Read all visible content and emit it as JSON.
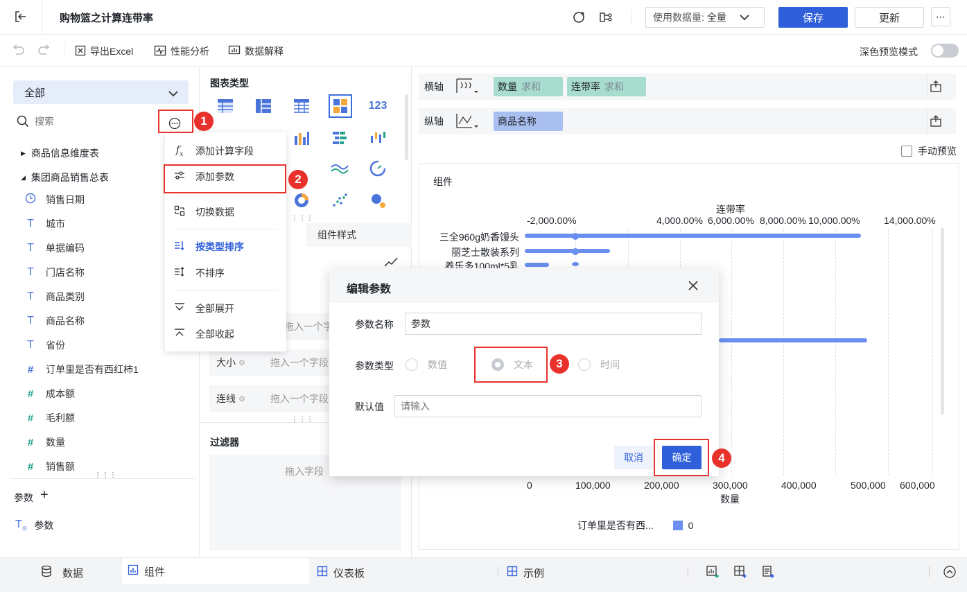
{
  "header": {
    "title": "购物篮之计算连带率",
    "data_volume_label": "使用数据量:",
    "data_volume_value": "全量",
    "save": "保存",
    "update": "更新"
  },
  "toolbar": {
    "export_excel": "导出Excel",
    "perf_analysis": "性能分析",
    "data_explain": "数据解释",
    "dark_preview": "深色预览模式"
  },
  "left": {
    "dataset_select": "全部",
    "search_placeholder": "搜索",
    "tables": [
      {
        "name": "商品信息维度表",
        "expanded": false
      },
      {
        "name": "集团商品销售总表",
        "expanded": true
      }
    ],
    "fields": [
      {
        "name": "销售日期",
        "type": "date"
      },
      {
        "name": "城市",
        "type": "text"
      },
      {
        "name": "单据编码",
        "type": "text"
      },
      {
        "name": "门店名称",
        "type": "text"
      },
      {
        "name": "商品类别",
        "type": "text"
      },
      {
        "name": "商品名称",
        "type": "text"
      },
      {
        "name": "省份",
        "type": "text"
      },
      {
        "name": "订单里是否有西红柿1",
        "type": "calc"
      },
      {
        "name": "成本额",
        "type": "number"
      },
      {
        "name": "毛利额",
        "type": "number"
      },
      {
        "name": "数量",
        "type": "number"
      },
      {
        "name": "销售额",
        "type": "number"
      }
    ],
    "params_label": "参数",
    "param_item": "参数"
  },
  "menu": {
    "items": [
      "添加计算字段",
      "添加参数",
      "切换数据",
      "按类型排序",
      "不排序",
      "全部展开",
      "全部收起"
    ]
  },
  "middle": {
    "chart_types_title": "图表类型",
    "style_tab": "组件样式",
    "slots": {
      "size": "大小",
      "line": "连线",
      "drop_hint": "拖入一个字段"
    },
    "filter_title": "过滤器",
    "filter_hint": "拖入字段"
  },
  "right": {
    "x_axis_label": "横轴",
    "y_axis_label": "纵轴",
    "x_pills": [
      {
        "name": "数量",
        "agg": "求和"
      },
      {
        "name": "连带率",
        "agg": "求和"
      }
    ],
    "y_pills": [
      {
        "name": "商品名称"
      }
    ],
    "manual_preview": "手动预览",
    "component_title": "组件"
  },
  "chart_data": {
    "type": "bar",
    "top_axis_title": "连带率",
    "top_ticks": [
      "-2,000.00%",
      "4,000.00%",
      "6,000.00%",
      "8,000.00%",
      "10,000.00%",
      "14,000.00%"
    ],
    "bottom_axis_title": "数量",
    "bottom_ticks": [
      "0",
      "100,000",
      "200,000",
      "300,000",
      "400,000",
      "500,000",
      "600,000"
    ],
    "categories": [
      "三全960g奶香馒头",
      "丽芝士散装系列",
      "养乐多100ml*5乳"
    ],
    "series": [
      {
        "values": [
          490000,
          124000,
          35000
        ]
      }
    ],
    "legend": {
      "label": "订单里是否有西...",
      "value": "0",
      "color": "#6b8ff0"
    }
  },
  "dialog": {
    "title": "编辑参数",
    "name_label": "参数名称",
    "name_value": "参数",
    "type_label": "参数类型",
    "type_options": [
      "数值",
      "文本",
      "时间"
    ],
    "default_label": "默认值",
    "default_placeholder": "请输入",
    "cancel": "取消",
    "ok": "确定"
  },
  "badges": [
    "1",
    "2",
    "3",
    "4"
  ],
  "bottom": {
    "tabs": [
      "数据",
      "组件",
      "仪表板",
      "示例"
    ]
  }
}
